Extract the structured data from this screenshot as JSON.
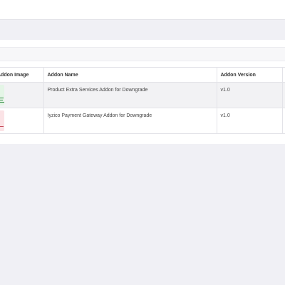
{
  "table": {
    "headers": {
      "image": "Addon Image",
      "name": "Addon Name",
      "version": "Addon Version",
      "extra": ""
    },
    "rows": [
      {
        "name": "Product Extra Services Addon for Downgrade",
        "version": "v1.0",
        "thumb_color": "#e4f5e6",
        "thumb_accent": "#3a8f4a"
      },
      {
        "name": "Iyzico Payment Gateway Addon for Downgrade",
        "version": "v1.0",
        "thumb_color": "#fbe3e6",
        "thumb_accent": "#c64a5a"
      }
    ]
  }
}
